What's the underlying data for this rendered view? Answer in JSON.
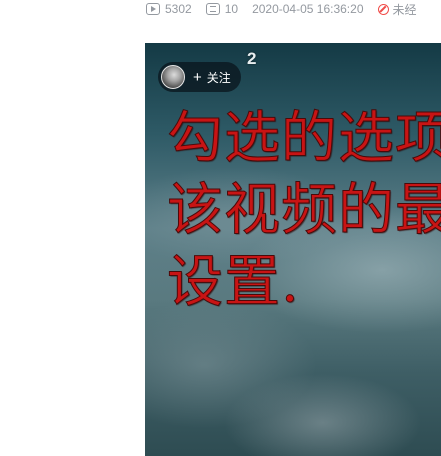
{
  "stats": {
    "views": "5302",
    "danmaku": "10",
    "datetime": "2020-04-05 16:36:20",
    "warning": "未经"
  },
  "video": {
    "count_badge": "2",
    "follow_label": "关注",
    "caption_lines": [
      "勾选的选项",
      "该视频的最",
      "设置."
    ]
  },
  "icons": {
    "views": "play-icon",
    "danmaku": "danmaku-icon",
    "warning": "prohibited-icon"
  },
  "colors": {
    "caption": "#c81414",
    "warning": "#f04c49",
    "meta": "#9499a0"
  }
}
